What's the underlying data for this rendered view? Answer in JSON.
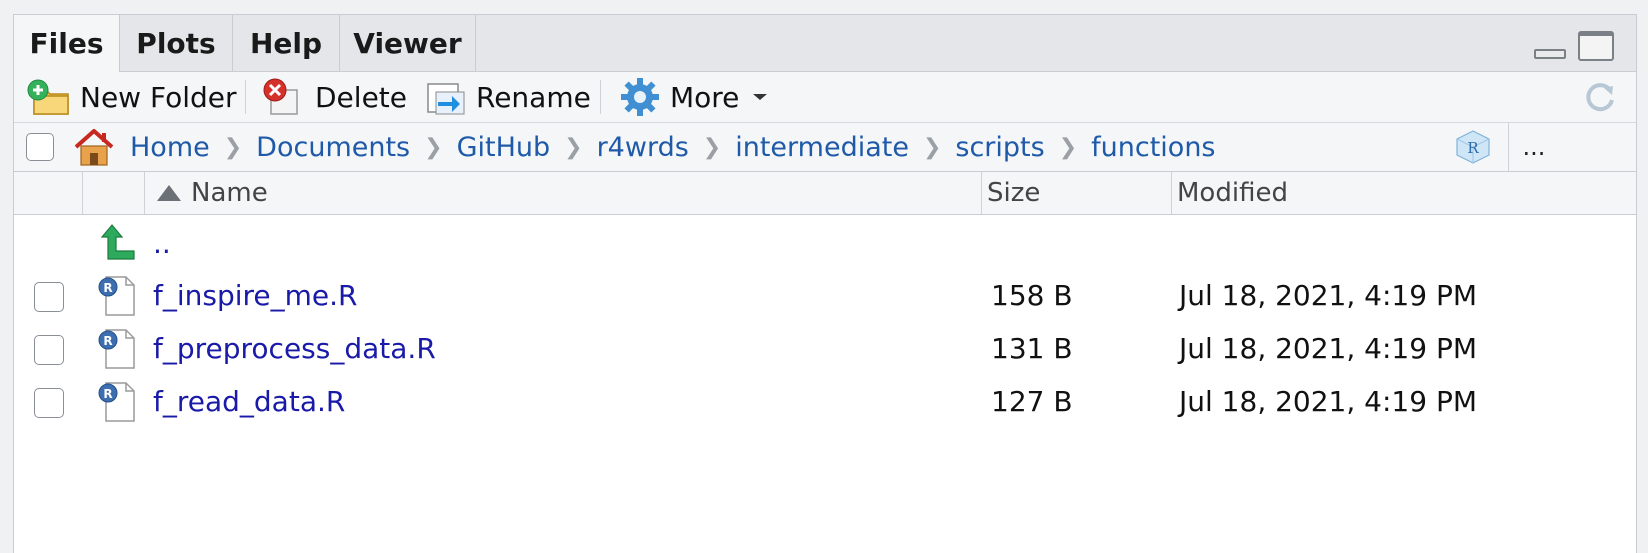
{
  "tabs": [
    "Files",
    "Plots",
    "Help",
    "Viewer"
  ],
  "toolbar": {
    "new_folder": "New Folder",
    "delete": "Delete",
    "rename": "Rename",
    "more": "More"
  },
  "breadcrumb": [
    "Home",
    "Documents",
    "GitHub",
    "r4wrds",
    "intermediate",
    "scripts",
    "functions"
  ],
  "more_dots": "...",
  "columns": {
    "name": "Name",
    "size": "Size",
    "modified": "Modified"
  },
  "parent_dir": "..",
  "files": [
    {
      "name": "f_inspire_me.R",
      "size": "158 B",
      "modified": "Jul 18, 2021, 4:19 PM"
    },
    {
      "name": "f_preprocess_data.R",
      "size": "131 B",
      "modified": "Jul 18, 2021, 4:19 PM"
    },
    {
      "name": "f_read_data.R",
      "size": "127 B",
      "modified": "Jul 18, 2021, 4:19 PM"
    }
  ],
  "colors": {
    "link": "#1a1aa8",
    "crumb": "#1f5aa8",
    "accent_green": "#2eaa5c"
  }
}
